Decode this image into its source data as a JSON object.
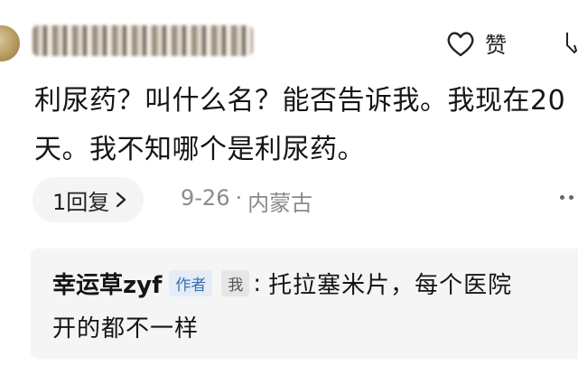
{
  "comment": {
    "text": "利尿药？叫什么名？能否告诉我。我现在20天。我不知哪个是利尿药。",
    "like_label": "赞",
    "reply_count_label": "1回复",
    "date": "9-26",
    "dot": "·",
    "location": "内蒙古"
  },
  "reply": {
    "author": "幸运草zyf",
    "author_badge": "作者",
    "me_badge": "我",
    "colon": ":",
    "text_line1": "托拉塞米片，每个医院",
    "text_line2": "开的都不一样"
  },
  "colors": {
    "reply_bg": "#f5f5f5",
    "author_badge": "#3d6fb0",
    "meta": "#8a8a8a"
  },
  "icons": [
    "heart-outline-icon",
    "thumb-down-icon",
    "chevron-right-icon",
    "more-dots-icon"
  ]
}
